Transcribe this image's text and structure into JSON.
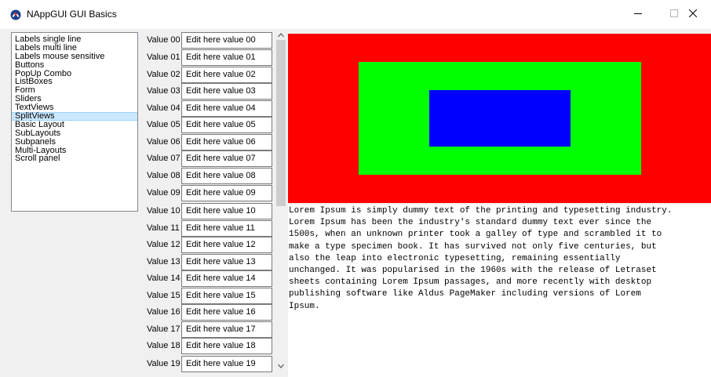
{
  "window": {
    "title": "NAppGUI GUI Basics"
  },
  "sidebar": {
    "items": [
      {
        "label": "Labels single line"
      },
      {
        "label": "Labels multi line"
      },
      {
        "label": "Labels mouse sensitive"
      },
      {
        "label": "Buttons"
      },
      {
        "label": "PopUp Combo"
      },
      {
        "label": "ListBoxes"
      },
      {
        "label": "Form"
      },
      {
        "label": "Sliders"
      },
      {
        "label": "TextViews"
      },
      {
        "label": "SplitViews"
      },
      {
        "label": "Basic Layout"
      },
      {
        "label": "SubLayouts"
      },
      {
        "label": "Subpanels"
      },
      {
        "label": "Multi-Layouts"
      },
      {
        "label": "Scroll panel"
      }
    ],
    "selected": "SplitViews"
  },
  "form": {
    "rows": [
      {
        "label": "Value 00",
        "value": "Edit here value 00"
      },
      {
        "label": "Value 01",
        "value": "Edit here value 01"
      },
      {
        "label": "Value 02",
        "value": "Edit here value 02"
      },
      {
        "label": "Value 03",
        "value": "Edit here value 03"
      },
      {
        "label": "Value 04",
        "value": "Edit here value 04"
      },
      {
        "label": "Value 05",
        "value": "Edit here value 05"
      },
      {
        "label": "Value 06",
        "value": "Edit here value 06"
      },
      {
        "label": "Value 07",
        "value": "Edit here value 07"
      },
      {
        "label": "Value 08",
        "value": "Edit here value 08"
      },
      {
        "label": "Value 09",
        "value": "Edit here value 09"
      },
      {
        "label": "Value 10",
        "value": "Edit here value 10"
      },
      {
        "label": "Value 11",
        "value": "Edit here value 11"
      },
      {
        "label": "Value 12",
        "value": "Edit here value 12"
      },
      {
        "label": "Value 13",
        "value": "Edit here value 13"
      },
      {
        "label": "Value 14",
        "value": "Edit here value 14"
      },
      {
        "label": "Value 15",
        "value": "Edit here value 15"
      },
      {
        "label": "Value 16",
        "value": "Edit here value 16"
      },
      {
        "label": "Value 17",
        "value": "Edit here value 17"
      },
      {
        "label": "Value 18",
        "value": "Edit here value 18"
      },
      {
        "label": "Value 19",
        "value": "Edit here value 19"
      }
    ]
  },
  "view": {
    "colors": {
      "outer": "#ff0000",
      "middle": "#00ff00",
      "inner": "#0000ff"
    }
  },
  "textview": {
    "lines": [
      "Lorem Ipsum is simply dummy text of the printing and typesetting industry.",
      "Lorem Ipsum has been the industry's standard dummy text ever since the",
      "1500s, when an unknown printer took a galley of type and scrambled it to",
      "make a type specimen book. It has survived not only five centuries, but",
      "also the leap into electronic typesetting, remaining essentially",
      "unchanged. It was popularised in the 1960s with the release of Letraset",
      "sheets containing Lorem Ipsum passages, and more recently with desktop",
      "publishing software like Aldus PageMaker including versions of Lorem",
      "Ipsum."
    ]
  },
  "icons": {
    "app": "nappgui-app-icon",
    "minimize": "minimize-icon",
    "maximize": "maximize-icon",
    "close": "close-icon",
    "scroll_up": "chevron-up-icon",
    "scroll_down": "chevron-down-icon"
  }
}
